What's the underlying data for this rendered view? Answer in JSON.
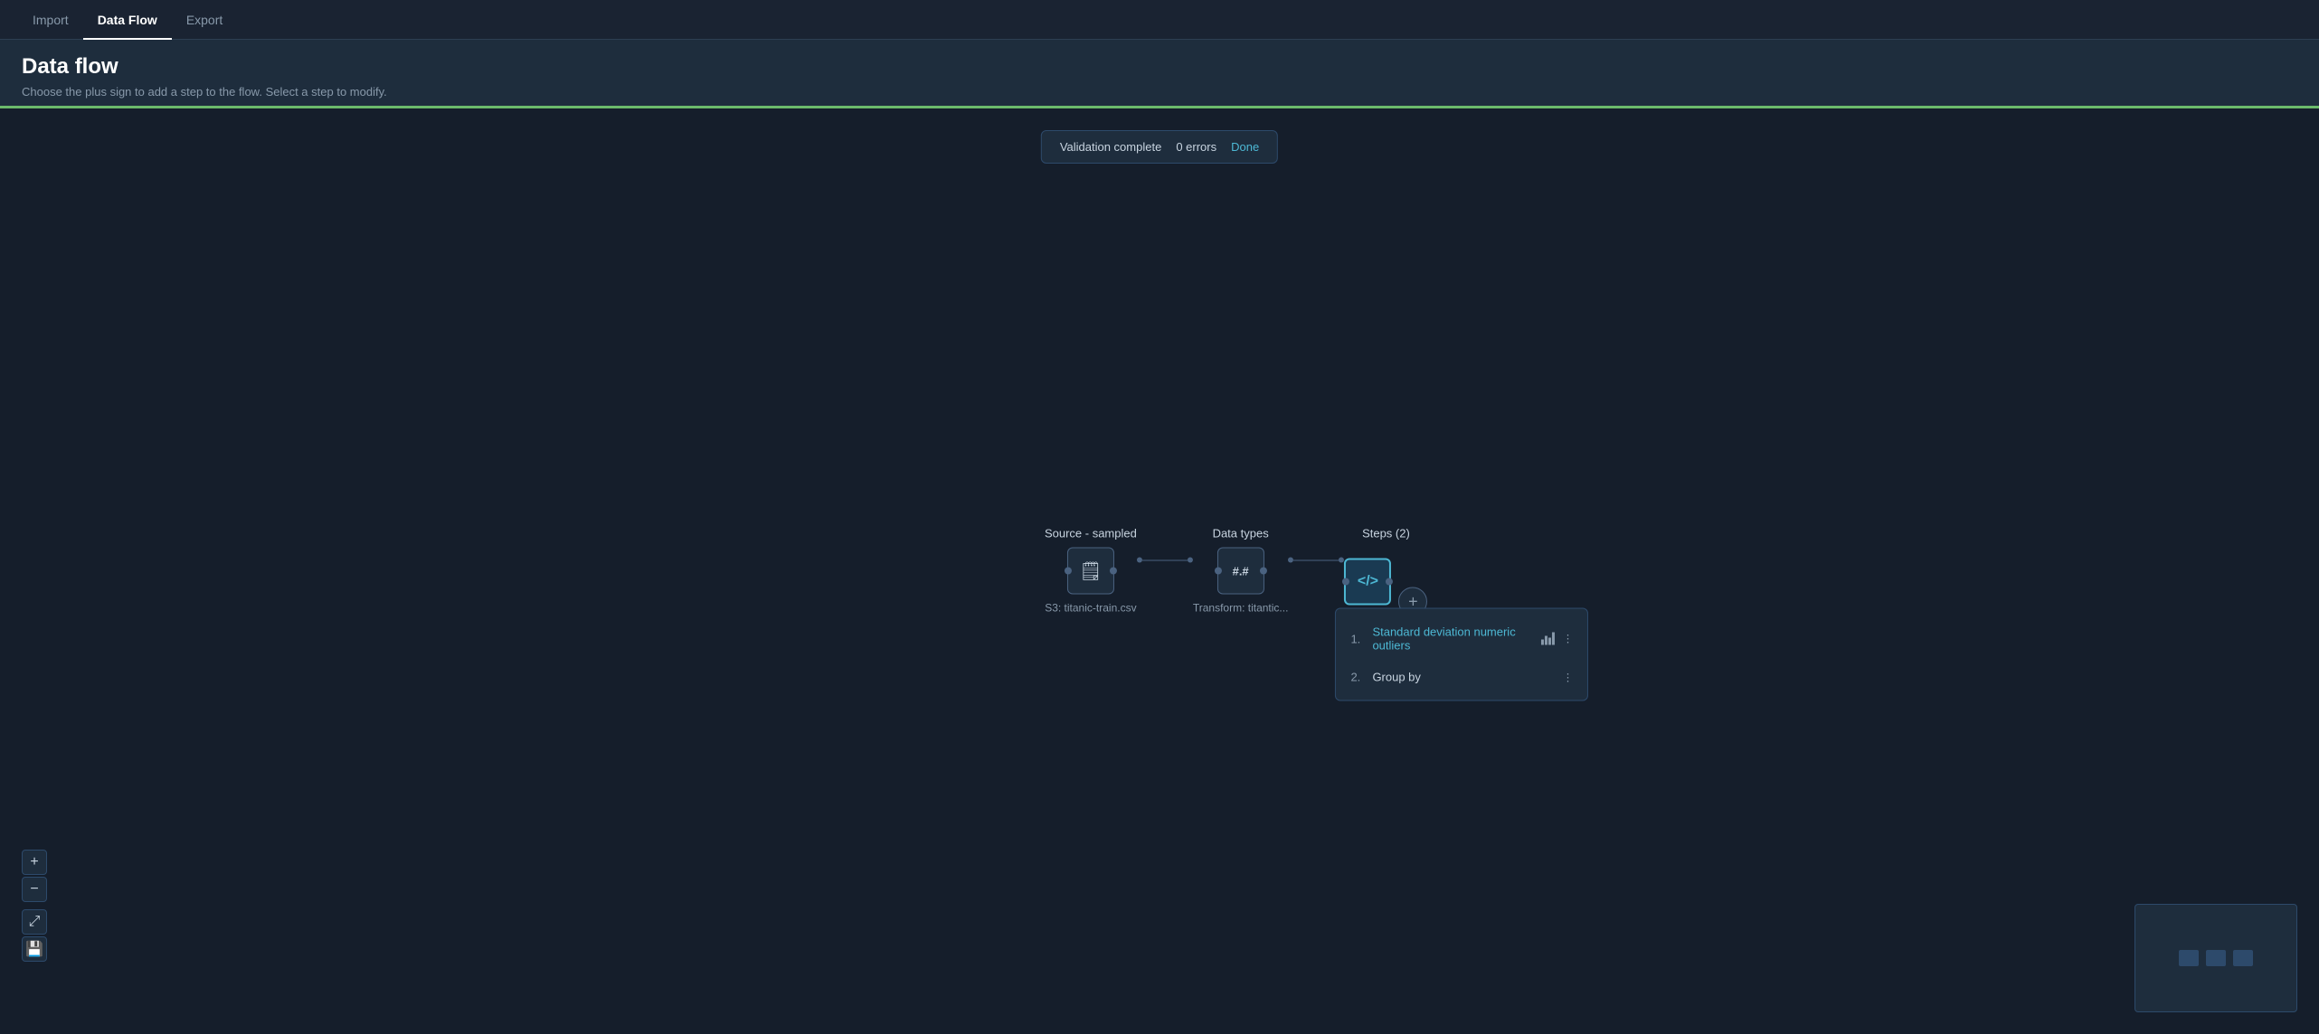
{
  "nav": {
    "tabs": [
      {
        "id": "import",
        "label": "Import",
        "active": false
      },
      {
        "id": "dataflow",
        "label": "Data Flow",
        "active": true
      },
      {
        "id": "export",
        "label": "Export",
        "active": false
      }
    ]
  },
  "header": {
    "title": "Data flow",
    "subtitle": "Choose the plus sign to add a step to the flow. Select a step to modify."
  },
  "validation": {
    "text": "Validation complete",
    "errors": "0 errors",
    "done_label": "Done"
  },
  "flow": {
    "nodes": [
      {
        "id": "source",
        "label": "Source - sampled",
        "sublabel": "S3: titanic-train.csv",
        "icon_type": "document"
      },
      {
        "id": "datatypes",
        "label": "Data types",
        "sublabel": "Transform: titantic...",
        "icon_type": "hash"
      },
      {
        "id": "steps",
        "label": "Steps (2)",
        "sublabel": "",
        "icon_type": "code",
        "highlighted": true
      }
    ],
    "add_button_label": "+"
  },
  "steps_popup": {
    "items": [
      {
        "number": "1.",
        "label": "Standard deviation numeric outliers",
        "has_chart": true,
        "has_menu": true
      },
      {
        "number": "2.",
        "label": "Group by",
        "has_chart": false,
        "has_menu": true
      }
    ]
  },
  "zoom_controls": {
    "zoom_in": "+",
    "zoom_out": "−",
    "fit": "⤢",
    "save": "💾"
  }
}
